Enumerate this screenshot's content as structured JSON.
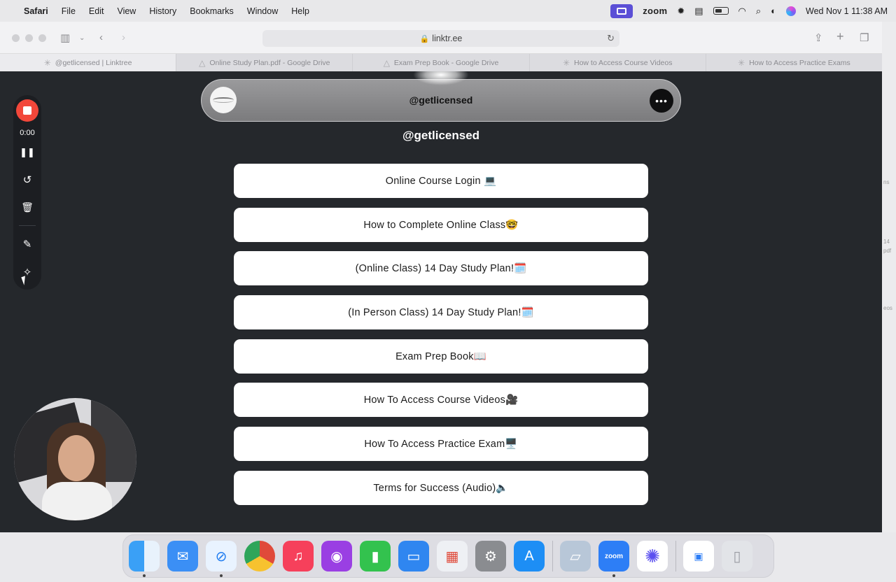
{
  "menubar": {
    "app": "Safari",
    "items": [
      "File",
      "Edit",
      "View",
      "History",
      "Bookmarks",
      "Window",
      "Help"
    ],
    "zoom_label": "zoom",
    "clock": "Wed Nov 1  11:38 AM"
  },
  "browser": {
    "url": "linktr.ee",
    "tabs": [
      {
        "label": "@getlicensed | Linktree",
        "icon": "linktree-icon",
        "active": true
      },
      {
        "label": "Online Study Plan.pdf - Google Drive",
        "icon": "google-drive-icon"
      },
      {
        "label": "Exam Prep Book - Google Drive",
        "icon": "google-drive-icon"
      },
      {
        "label": "How to Access Course Videos",
        "icon": "linktree-icon"
      },
      {
        "label": "How to Access Practice Exams",
        "icon": "linktree-icon"
      }
    ]
  },
  "page": {
    "header_title": "@getlicensed",
    "profile_name": "@getlicensed",
    "links": [
      "Online Course Login 💻",
      "How to Complete Online Class🤓",
      "(Online Class) 14 Day Study Plan!🗓️",
      "(In Person Class) 14 Day Study Plan!🗓️",
      "Exam Prep Book📖",
      "How To Access Course Videos🎥",
      "How To Access Practice Exam🖥️",
      "Terms for Success (Audio)🔈"
    ],
    "background_color": "#25282c"
  },
  "recorder": {
    "timer": "0:00",
    "accent": "#f2473a"
  },
  "right_edge_fragments": [
    "ns",
    "14",
    "pdf",
    "eos"
  ],
  "dock": {
    "apps": [
      "Finder",
      "Mail",
      "Safari",
      "Chrome",
      "Music",
      "Podcasts",
      "Numbers",
      "Keynote",
      "Launchpad",
      "System Settings",
      "App Store",
      "Preview",
      "Zoom",
      "Perplexity",
      "Zoom Window",
      "Trash"
    ],
    "zoom_label": "zoom"
  }
}
